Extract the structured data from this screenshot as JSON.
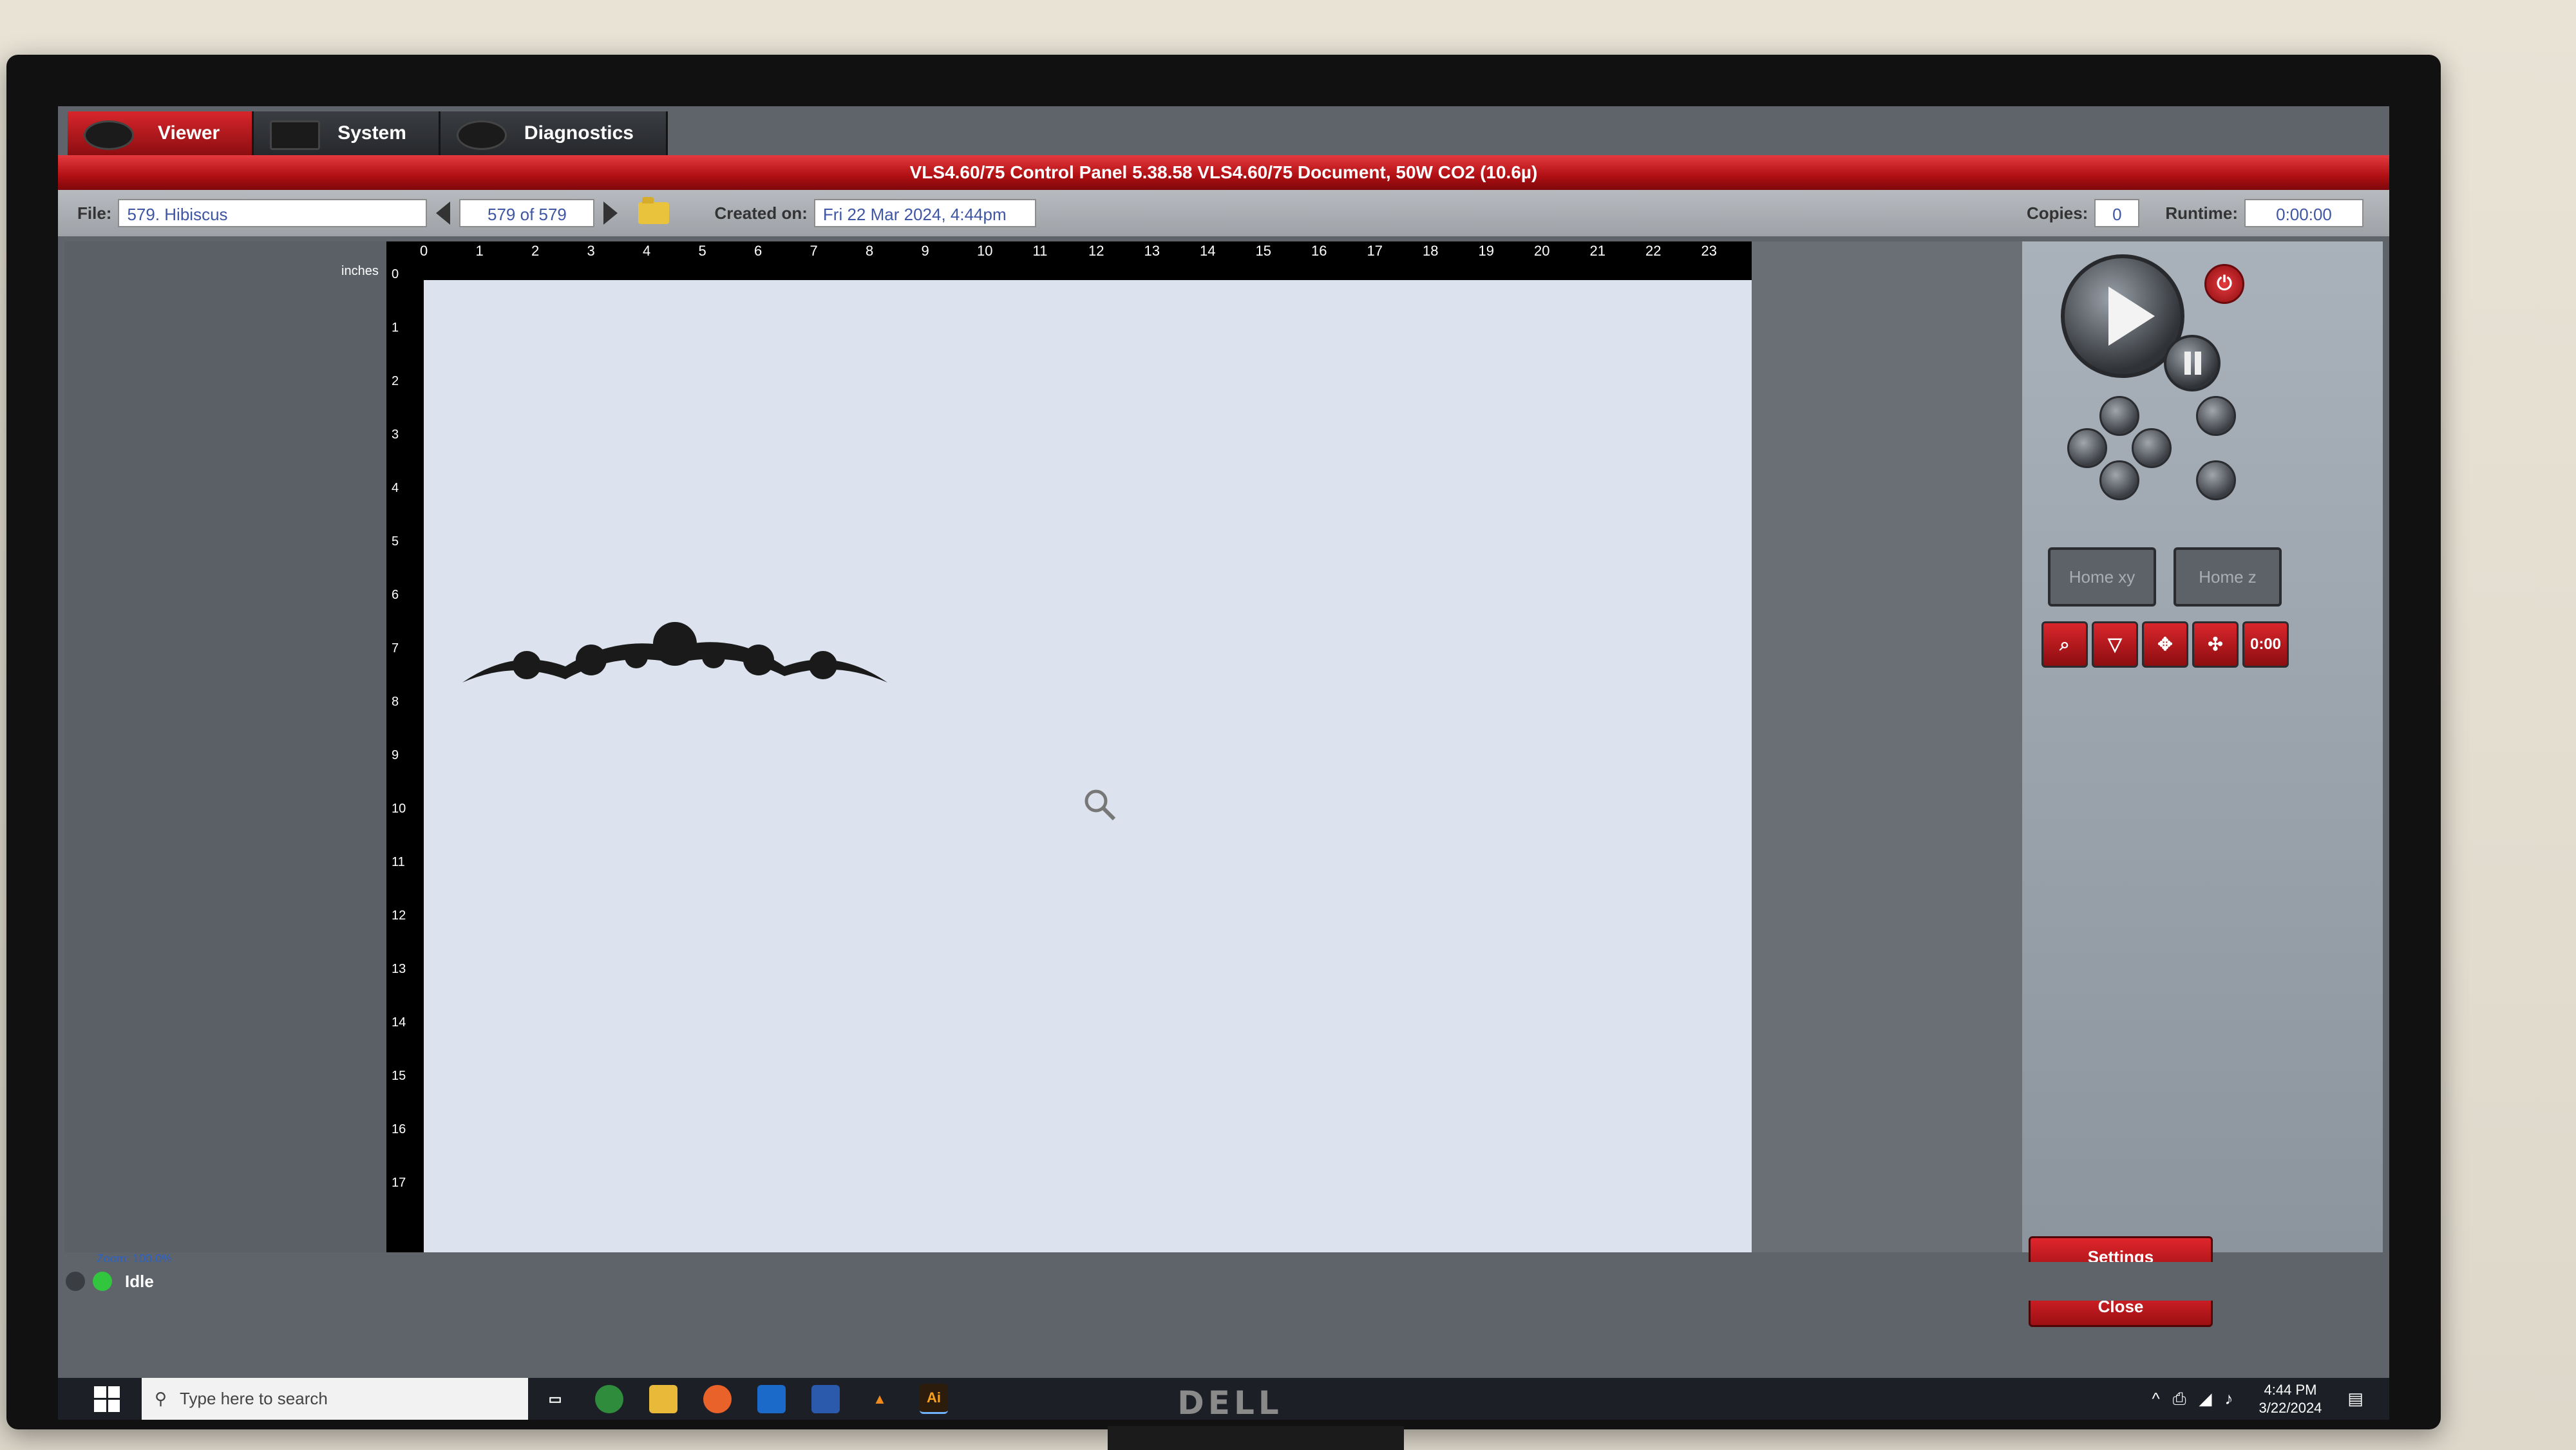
{
  "tabs": [
    {
      "label": "Viewer",
      "active": true
    },
    {
      "label": "System",
      "active": false
    },
    {
      "label": "Diagnostics",
      "active": false
    }
  ],
  "title_bar": "VLS4.60/75  Control Panel   5.38.58    VLS4.60/75 Document, 50W CO2 (10.6µ)",
  "file_bar": {
    "file_label": "File:",
    "file_value": "579. Hibiscus",
    "page_indicator": "579 of 579",
    "created_label": "Created on:",
    "created_value": "Fri 22 Mar 2024,  4:44pm",
    "copies_label": "Copies:",
    "copies_value": "0",
    "runtime_label": "Runtime:",
    "runtime_value": "0:00:00"
  },
  "ruler": {
    "unit": "inches",
    "top_ticks": [
      "0",
      "1",
      "2",
      "3",
      "4",
      "5",
      "6",
      "7",
      "8",
      "9",
      "10",
      "11",
      "12",
      "13",
      "14",
      "15",
      "16",
      "17",
      "18",
      "19",
      "20",
      "21",
      "22",
      "23"
    ],
    "left_ticks": [
      "0",
      "1",
      "2",
      "3",
      "4",
      "5",
      "6",
      "7",
      "8",
      "9",
      "10",
      "11",
      "12",
      "13",
      "14",
      "15",
      "16",
      "17"
    ]
  },
  "controls": {
    "home_xy": "Home xy",
    "home_z": "Home z",
    "timer_label": "0:00",
    "settings": "Settings",
    "close": "Close"
  },
  "zoom_label": "Zoom: 100.0%",
  "status": "Idle",
  "taskbar": {
    "search_placeholder": "Type here to search",
    "time": "4:44 PM",
    "date": "3/22/2024",
    "ai_label": "Ai"
  },
  "monitor_brand": "DELL",
  "colors": {
    "accent_red": "#c8161b",
    "field_text": "#3f56a4"
  }
}
